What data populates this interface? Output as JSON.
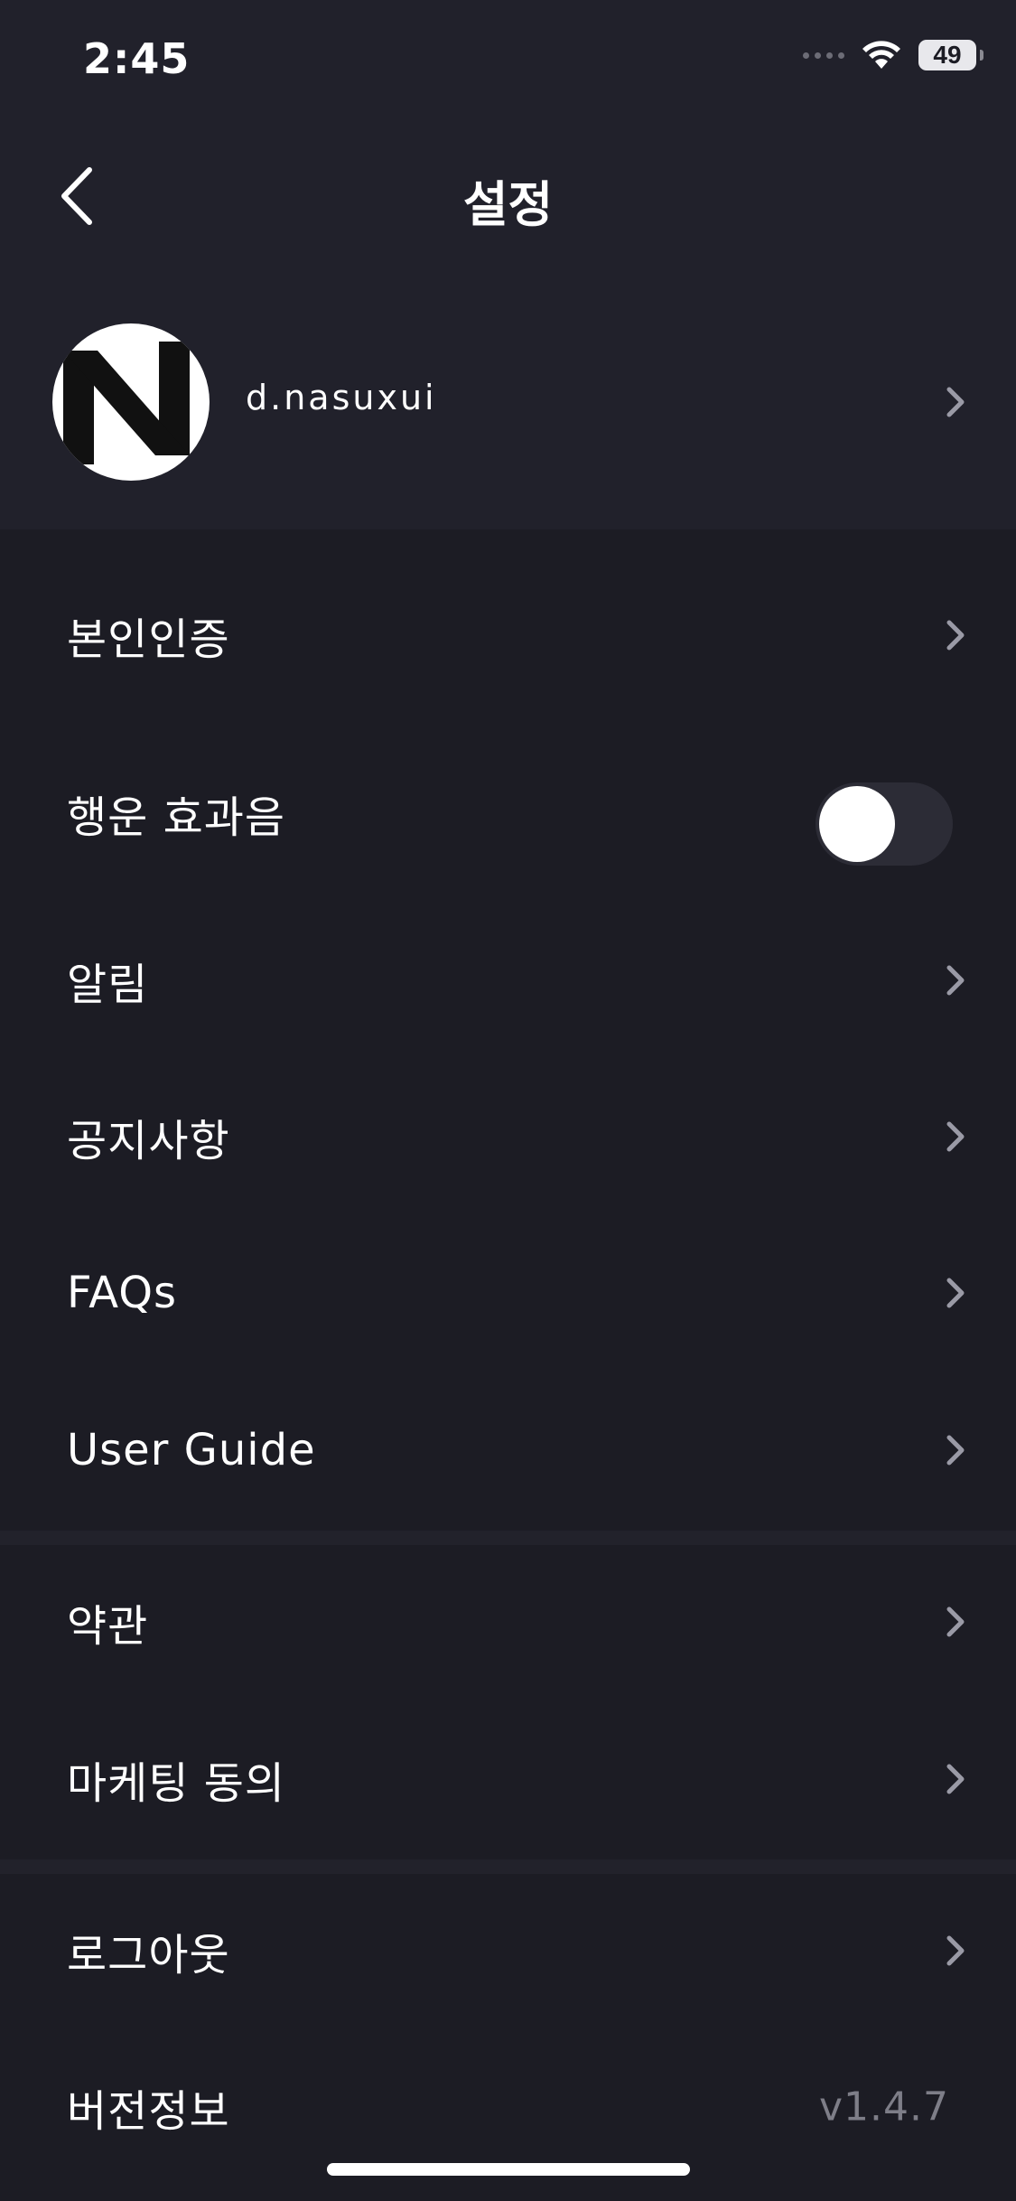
{
  "status_bar": {
    "time": "2:45",
    "battery": "49",
    "icons": [
      "cellular-signal-icon",
      "wifi-icon",
      "battery-icon"
    ]
  },
  "header": {
    "title": "설정",
    "back_icon": "chevron-left-icon"
  },
  "profile": {
    "username": "d.nasuxui",
    "avatar_icon": "avatar-n-logo"
  },
  "menu": {
    "identity": "본인인증",
    "lucky_sound": "행운 효과음",
    "lucky_sound_on": false,
    "notifications": "알림",
    "notices": "공지사항",
    "faqs": "FAQs",
    "user_guide": "User Guide",
    "terms": "약관",
    "marketing": "마케팅 동의",
    "logout": "로그아웃",
    "version_label": "버전정보",
    "version_value": "v1.4.7"
  },
  "colors": {
    "background": "#1c1c24",
    "header_background": "#21212b",
    "text": "#ffffff",
    "muted_text": "#7e7e88",
    "chevron": "#9a9aa6"
  }
}
